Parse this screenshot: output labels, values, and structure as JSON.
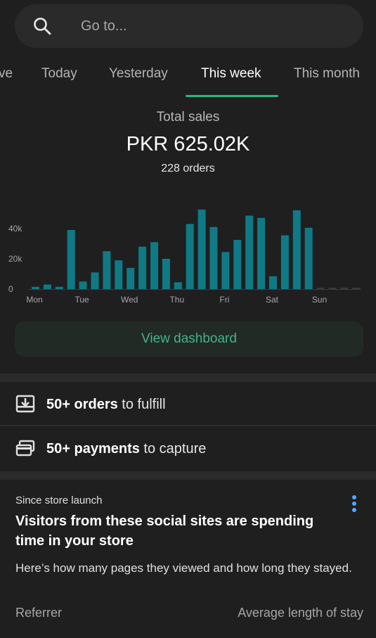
{
  "search": {
    "placeholder": "Go to...",
    "icon": "search-icon"
  },
  "tabs": [
    {
      "label": "ve",
      "active": false
    },
    {
      "label": "Today",
      "active": false
    },
    {
      "label": "Yesterday",
      "active": false
    },
    {
      "label": "This week",
      "active": true
    },
    {
      "label": "This month",
      "active": false
    }
  ],
  "summary": {
    "label": "Total sales",
    "value": "PKR 625.02K",
    "orders": "228 orders"
  },
  "chart_data": {
    "type": "bar",
    "y_ticks": [
      "0",
      "20k",
      "40k"
    ],
    "ylim": [
      0,
      52000
    ],
    "x_labels": [
      "Mon",
      "Tue",
      "Wed",
      "Thu",
      "Fri",
      "Sat",
      "Sun"
    ],
    "values": [
      1500,
      3000,
      1500,
      39000,
      5000,
      11000,
      25000,
      19000,
      14000,
      28000,
      31000,
      20000,
      4500,
      43000,
      52500,
      41000,
      24500,
      32500,
      48500,
      47000,
      8500,
      35500,
      52000,
      40500,
      0,
      0,
      0,
      0
    ],
    "bar_color": "#0f7a85",
    "grid": false
  },
  "dashboard_button": {
    "label": "View dashboard",
    "color": "#43b38a"
  },
  "tasks": [
    {
      "bold": "50+ orders",
      "rest": " to fulfill",
      "icon": "download-tray-icon"
    },
    {
      "bold": "50+ payments",
      "rest": " to capture",
      "icon": "credit-card-icon"
    }
  ],
  "card": {
    "kicker": "Since store launch",
    "title": "Visitors from these social sites are spending time in your store",
    "description": "Here’s how many pages they viewed and how long they stayed.",
    "col_left": "Referrer",
    "col_right": "Average length of stay",
    "menu_icon": "more-vert-icon"
  }
}
